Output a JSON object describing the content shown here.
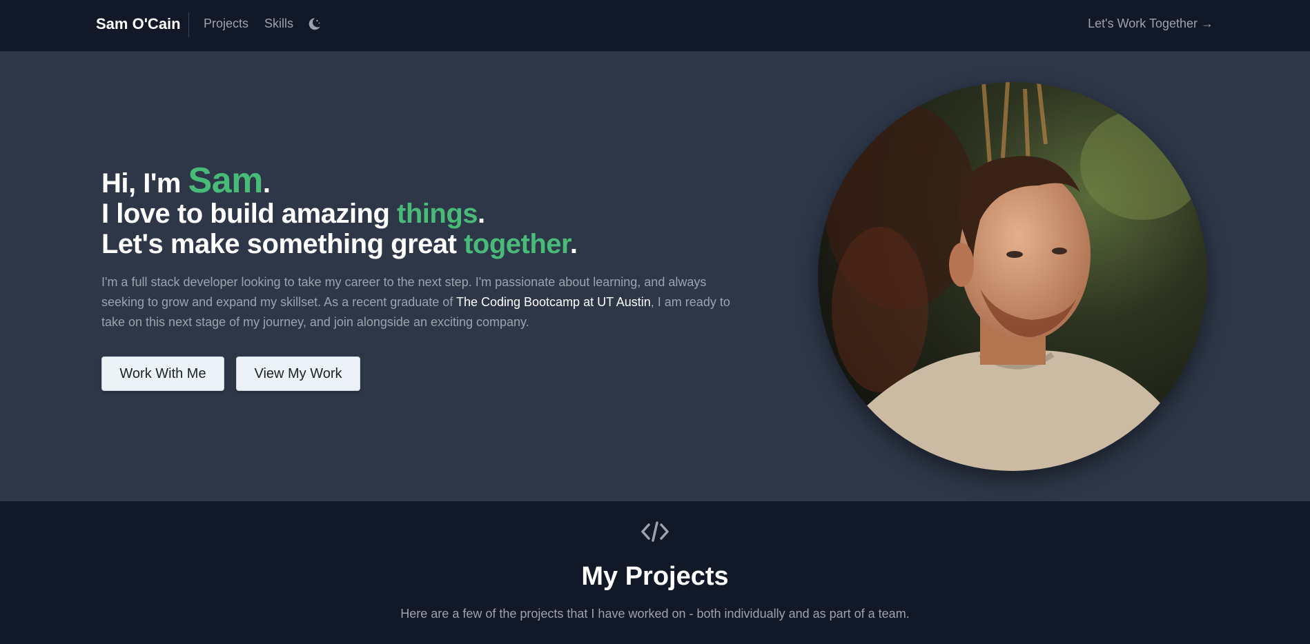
{
  "nav": {
    "brand": "Sam O'Cain",
    "links": [
      "Projects",
      "Skills"
    ],
    "theme_icon": "moon-icon",
    "cta": "Let's Work Together →"
  },
  "hero": {
    "greeting_prefix": "Hi, I'm ",
    "name": "Sam",
    "line2_prefix": "I love to build amazing ",
    "line2_highlight": "things",
    "line3_prefix": "Let's make something great ",
    "line3_highlight": "together",
    "period": ".",
    "intro_before": "I'm a full stack developer looking to take my career to the next step. I'm passionate about learning, and always seeking to grow and expand my skillset. As a recent graduate of ",
    "intro_highlight": "The Coding Bootcamp at UT Austin",
    "intro_after": ", I am ready to take on this next stage of my journey, and join alongside an exciting company.",
    "buttons": [
      "Work With Me",
      "View My Work"
    ]
  },
  "projects": {
    "icon": "code-icon",
    "title": "My Projects",
    "subtitle": "Here are a few of the projects that I have worked on - both individually and as part of a team."
  },
  "colors": {
    "accent": "#48bb78",
    "hero_bg": "#2d3748",
    "nav_bg": "#111827"
  }
}
